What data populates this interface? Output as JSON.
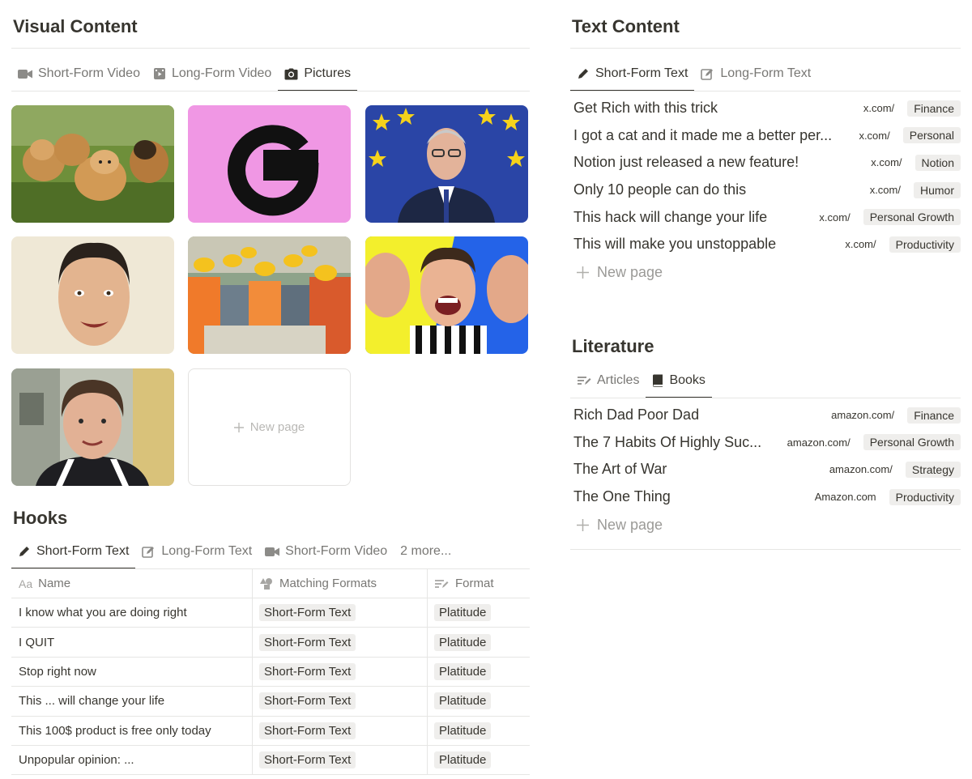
{
  "visual": {
    "title": "Visual Content",
    "tabs": [
      {
        "label": "Short-Form Video",
        "icon": "video-camera-icon",
        "active": false
      },
      {
        "label": "Long-Form Video",
        "icon": "film-icon",
        "active": false
      },
      {
        "label": "Pictures",
        "icon": "camera-icon",
        "active": true
      }
    ],
    "gallery": [
      {
        "image": "golden-retriever-puppies-photo"
      },
      {
        "image": "pink-g-logo"
      },
      {
        "image": "man-with-eu-flag-photo"
      },
      {
        "image": "smiling-face-cutout-photo"
      },
      {
        "image": "construction-workers-photo"
      },
      {
        "image": "excited-youtuber-thumbnail"
      },
      {
        "image": "boy-portrait-photo"
      }
    ],
    "new_page": "New page"
  },
  "hooks": {
    "title": "Hooks",
    "tabs": [
      {
        "label": "Short-Form Text",
        "icon": "pencil-icon",
        "active": true
      },
      {
        "label": "Long-Form Text",
        "icon": "edit-square-icon",
        "active": false
      },
      {
        "label": "Short-Form Video",
        "icon": "video-camera-icon",
        "active": false
      },
      {
        "label": "2 more...",
        "icon": "",
        "active": false
      }
    ],
    "columns": [
      {
        "label": "Name",
        "icon": "text-type-icon"
      },
      {
        "label": "Matching Formats",
        "icon": "shapes-icon"
      },
      {
        "label": "Format",
        "icon": "list-lines-icon"
      }
    ],
    "rows": [
      {
        "name": "I know what you are doing right",
        "matching": "Short-Form Text",
        "format": "Platitude"
      },
      {
        "name": "I QUIT",
        "matching": "Short-Form Text",
        "format": "Platitude"
      },
      {
        "name": "Stop right now",
        "matching": "Short-Form Text",
        "format": "Platitude"
      },
      {
        "name": "This ... will change your life",
        "matching": "Short-Form Text",
        "format": "Platitude"
      },
      {
        "name": "This 100$ product is free only today",
        "matching": "Short-Form Text",
        "format": "Platitude"
      },
      {
        "name": "Unpopular opinion: ...",
        "matching": "Short-Form Text",
        "format": "Platitude"
      }
    ]
  },
  "text": {
    "title": "Text Content",
    "tabs": [
      {
        "label": "Short-Form Text",
        "icon": "pencil-icon",
        "active": true
      },
      {
        "label": "Long-Form Text",
        "icon": "edit-square-icon",
        "active": false
      }
    ],
    "rows": [
      {
        "title": "Get Rich with this trick",
        "url": "x.com/",
        "tag": "Finance"
      },
      {
        "title": "I got a cat and it made me a better per...",
        "url": "x.com/",
        "tag": "Personal"
      },
      {
        "title": "Notion just released a new feature!",
        "url": "x.com/",
        "tag": "Notion"
      },
      {
        "title": "Only 10 people can do this",
        "url": "x.com/",
        "tag": "Humor"
      },
      {
        "title": "This hack will change your life",
        "url": "x.com/",
        "tag": "Personal Growth"
      },
      {
        "title": "This will make you unstoppable",
        "url": "x.com/",
        "tag": "Productivity"
      }
    ],
    "new_page": "New page"
  },
  "literature": {
    "title": "Literature",
    "tabs": [
      {
        "label": "Articles",
        "icon": "list-lines-icon",
        "active": false
      },
      {
        "label": "Books",
        "icon": "book-icon",
        "active": true
      }
    ],
    "rows": [
      {
        "title": "Rich Dad Poor Dad",
        "url": "amazon.com/",
        "tag": "Finance"
      },
      {
        "title": "The 7 Habits Of Highly Suc...",
        "url": "amazon.com/",
        "tag": "Personal Growth"
      },
      {
        "title": "The Art of War",
        "url": "amazon.com/",
        "tag": "Strategy"
      },
      {
        "title": "The One Thing",
        "url": "Amazon.com",
        "tag": "Productivity"
      }
    ],
    "new_page": "New page"
  }
}
